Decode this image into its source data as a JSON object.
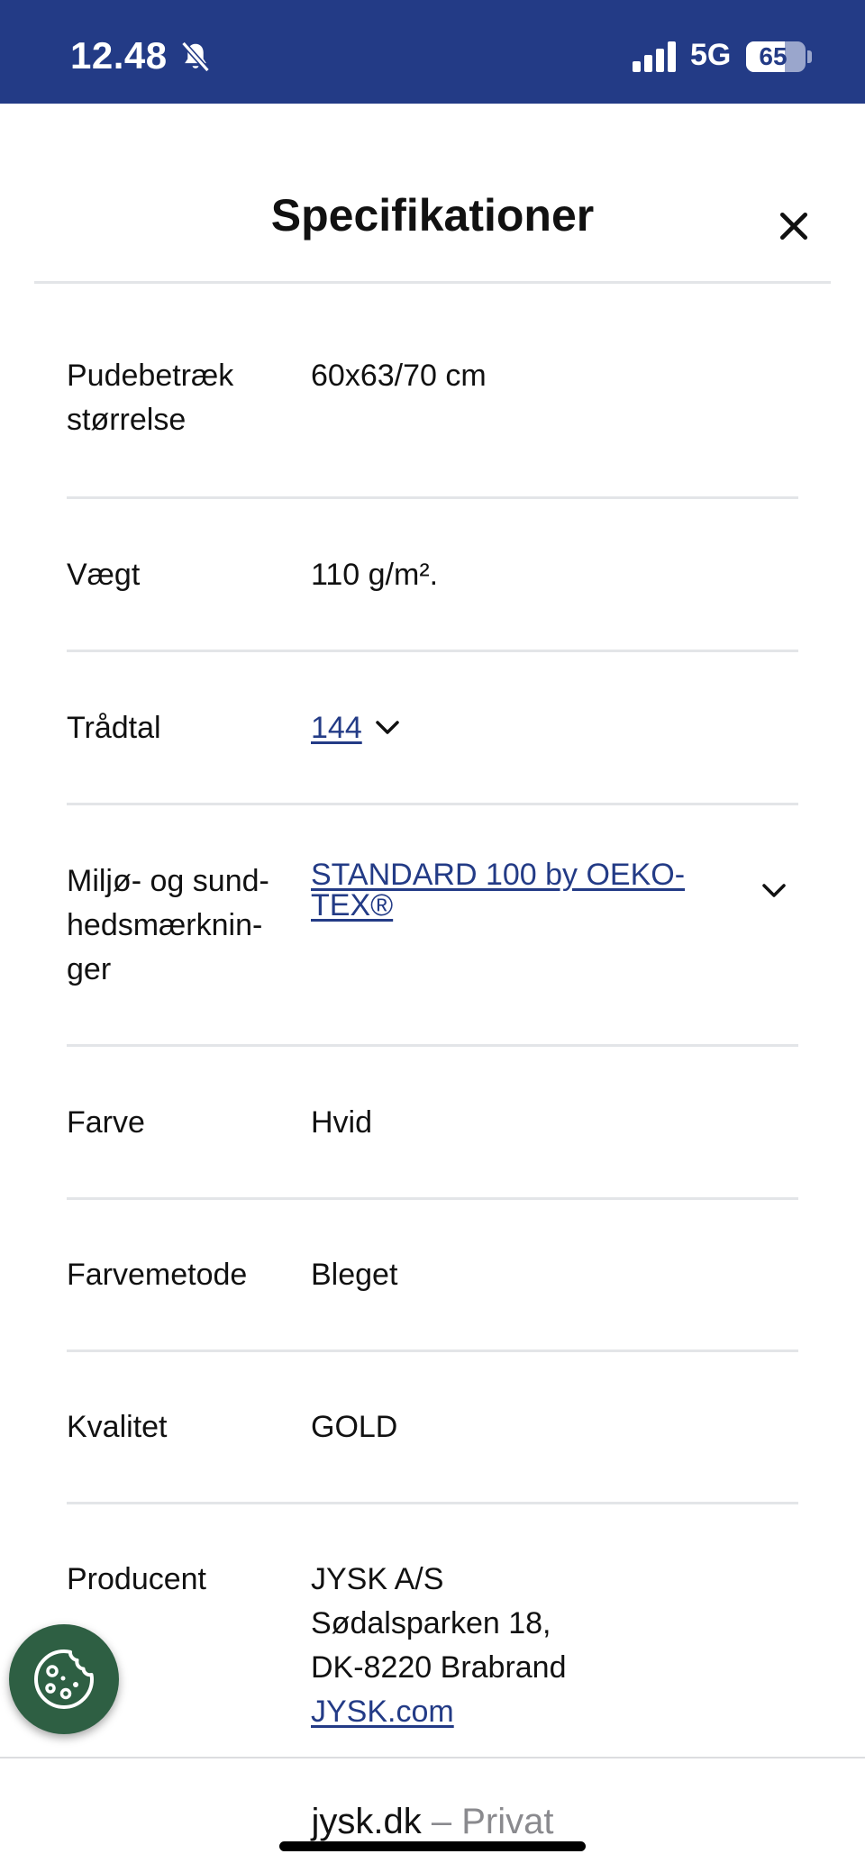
{
  "status_bar": {
    "time": "12.48",
    "network": "5G",
    "battery_level": "65",
    "battery_fraction": 0.65,
    "icons": {
      "silent": "bell-slash-icon",
      "signal": "signal-bars-icon",
      "battery": "battery-icon"
    }
  },
  "dialog": {
    "title": "Specifikationer",
    "close_icon": "close-icon"
  },
  "specs": [
    {
      "label": "Pudebetræk størrelse",
      "value": "60x63/70 cm"
    },
    {
      "label": "Vægt",
      "value": "110 g/m²."
    },
    {
      "label": "Trådtal",
      "value": "144",
      "link": true,
      "expand_icon": "chevron-down-icon"
    },
    {
      "label": "Miljø- og sund­hedsmærknin­ger",
      "value": "STANDARD 100 by OEKO-TEX®",
      "link": true,
      "expand_icon": "chevron-down-icon"
    },
    {
      "label": "Farve",
      "value": "Hvid"
    },
    {
      "label": "Farvemetode",
      "value": "Bleget"
    },
    {
      "label": "Kvalitet",
      "value": "GOLD"
    },
    {
      "label": "Producent",
      "value_lines": [
        "JYSK A/S",
        "Sødalsparken 18,",
        "DK-8220 Brabrand"
      ],
      "link_text": "JYSK.com"
    }
  ],
  "cookie_button": {
    "icon": "cookie-icon"
  },
  "browser_bar": {
    "domain": "jysk.dk",
    "separator": " – ",
    "mode": "Privat"
  },
  "colors": {
    "brand_blue": "#233b86",
    "cookie_green": "#2e5f43",
    "divider": "#e3e5e8"
  }
}
